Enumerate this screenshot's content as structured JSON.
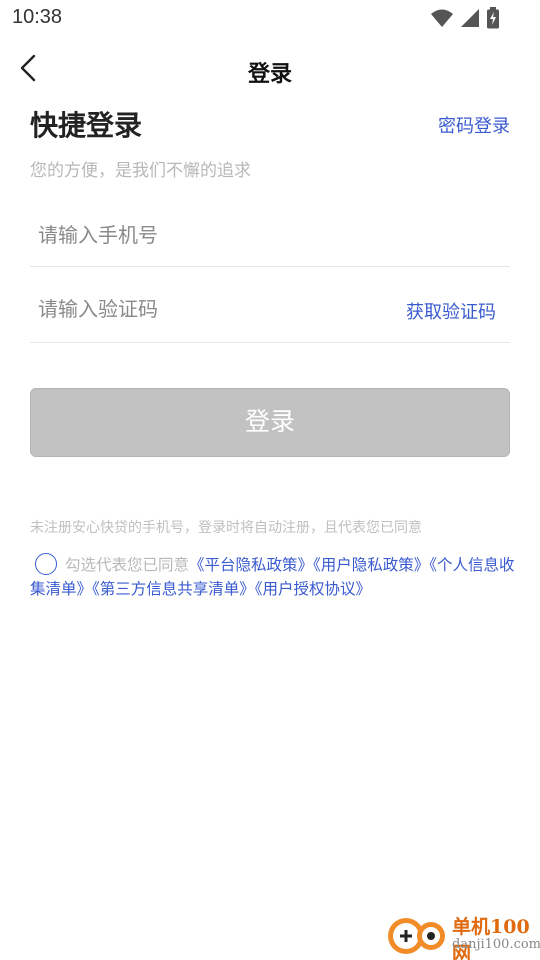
{
  "status_bar": {
    "time": "10:38",
    "icons": [
      "wifi-icon",
      "cellular-signal-icon",
      "battery-charging-icon"
    ]
  },
  "nav": {
    "back_icon": "chevron-left-icon",
    "title": "登录"
  },
  "login": {
    "heading": "快捷登录",
    "password_login_link": "密码登录",
    "subtitle": "您的方便，是我们不懈的追求",
    "phone_placeholder": "请输入手机号",
    "code_placeholder": "请输入验证码",
    "get_code_label": "获取验证码",
    "submit_label": "登录"
  },
  "agreement": {
    "notice": "未注册安心快贷的手机号，登录时将自动注册，且代表您已同意",
    "checkbox_prefix": "勾选代表您已同意",
    "links": [
      "《平台隐私政策》",
      "《用户隐私政策》",
      "《个人信息收集清单》",
      "《第三方信息共享清单》",
      "《用户授权协议》"
    ]
  },
  "watermark": {
    "name": "单机100网",
    "url": "danji100.com"
  },
  "colors": {
    "accent": "#3a5bd0",
    "button_disabled": "#c2c2c2",
    "hint_text": "#b8b8b8",
    "watermark_orange": "#e06a10"
  }
}
